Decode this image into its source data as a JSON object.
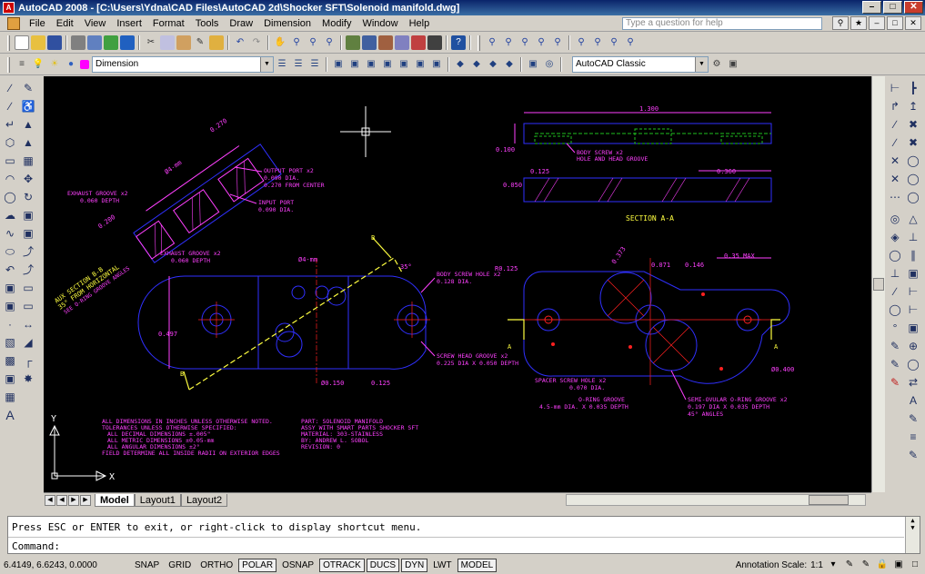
{
  "window": {
    "title": "AutoCAD 2008 - [C:\\Users\\Ydna\\CAD Files\\AutoCAD 2d\\Shocker SFT\\Solenoid manifold.dwg]",
    "app_icon": "autocad-logo-icon",
    "minimize": "–",
    "maximize": "□",
    "close": "✕"
  },
  "menu": {
    "items": [
      "File",
      "Edit",
      "View",
      "Insert",
      "Format",
      "Tools",
      "Draw",
      "Dimension",
      "Modify",
      "Window",
      "Help"
    ],
    "search_placeholder": "Type a question for help",
    "doc_controls": [
      "–",
      "□",
      "✕"
    ]
  },
  "toolbars": {
    "layer_name": "Dimension",
    "workspace": "AutoCAD Classic"
  },
  "layout_tabs": [
    "Model",
    "Layout1",
    "Layout2"
  ],
  "ucs": {
    "y_label": "Y",
    "x_label": "X"
  },
  "command": {
    "history": "Press ESC or ENTER to exit, or right-click to display shortcut menu.",
    "prompt": "Command:"
  },
  "status": {
    "coordinates": "6.4149, 6.6243, 0.0000",
    "buttons": [
      "SNAP",
      "GRID",
      "ORTHO",
      "POLAR",
      "OSNAP",
      "OTRACK",
      "DUCS",
      "DYN",
      "LWT",
      "MODEL"
    ],
    "buttons_on": [
      "POLAR",
      "OTRACK",
      "DUCS",
      "DYN",
      "MODEL"
    ],
    "annotation_scale_label": "Annotation Scale:",
    "annotation_scale_value": "1:1"
  },
  "drawing": {
    "colors": {
      "outline": "#3030ff",
      "text": "#ff40ff",
      "dim": "#ff40ff",
      "center": "#ff2020",
      "hatch": "#ff40ff",
      "hidden": "#20c020",
      "section": "#ffff40",
      "crosshair": "#ffffff"
    },
    "notes_general": [
      "ALL DIMENSIONS IN INCHES UNLESS OTHERWISE NOTED.",
      "TOLERANCES UNLESS OTHERWISE SPECIFIED:",
      "ALL DECIMAL DIMENSIONS ±.005\"",
      "ALL METRIC DIMENSIONS ±0.05-mm",
      "ALL ANGULAR DIMENSIONS ±2°",
      "FIELD DETERMINE ALL INSIDE RADII ON EXTERIOR EDGES"
    ],
    "notes_part": [
      "PART: SOLENOID MANIFOLD",
      "ASSY WITH SMART PARTS SHOCKER SFT",
      "MATERIAL: 303-STAINLESS",
      "BY: ANDREW L. SOBOL",
      "REVISION: 0"
    ],
    "section_label": "SECTION A-A",
    "aux_label_1": "AUX SECTION B-B",
    "aux_label_2": "35° FROM HORIZONTAL",
    "aux_label_3": "SEE O-RING GROOVE ANGLES",
    "labels": {
      "exhaust_groove_aux": "EXHAUST GROOVE x2",
      "exhaust_groove_aux_depth": "0.060 DEPTH",
      "output_port": "OUTPUT PORT x2",
      "output_port_dia": "0.090 DIA.",
      "output_port_center": "0.270 FROM CENTER",
      "input_port": "INPUT PORT",
      "input_port_dia": "0.090 DIA.",
      "dim_0270": "0.270",
      "dim_4mm": "Ø4-mm",
      "dim_0200": "0.200",
      "dim_1300": "1.300",
      "dim_0100": "0.100",
      "body_screw_groove": "BODY SCREW x2",
      "body_screw_groove_2": "HOLE AND HEAD GROOVE",
      "dim_0125_top": "0.125",
      "dim_0360": "0.360",
      "dim_0050": "0.050",
      "exhaust_groove": "EXHAUST GROOVE x2",
      "exhaust_groove_depth": "0.060 DEPTH",
      "dim_4mm_front": "Ø4-mm",
      "dim_35": "35°",
      "body_screw_hole": "BODY SCREW HOLE x2",
      "body_screw_hole_dia": "0.128 DIA.",
      "dim_0497": "0.497",
      "screw_head_groove": "SCREW HEAD GROOVE x2",
      "screw_head_groove_2": "0.225 DIA X 0.050 DEPTH",
      "dim_0150": "Ø0.150",
      "dim_0125_front": "0.125",
      "section_b_top": "B",
      "section_b_bottom": "B",
      "r0125": "R0.125",
      "dim_0373": "0.373",
      "dim_0071": "0.071",
      "dim_0146": "0.146",
      "dim_035max": "0.35 MAX",
      "section_a_left": "A",
      "section_a_right": "A",
      "spacer_screw_hole": "SPACER SCREW HOLE x2",
      "spacer_screw_hole_dia": "0.070 DIA.",
      "oring_groove": "O-RING GROOVE",
      "oring_groove_2": "4.5-mm DIA. X 0.035 DEPTH",
      "semi_oval": "SEMI-OVULAR O-RING GROOVE x2",
      "semi_oval_2": "0.197 DIA X 0.035 DEPTH",
      "semi_oval_3": "45° ANGLES",
      "dim_0400": "Ø0.400"
    }
  }
}
